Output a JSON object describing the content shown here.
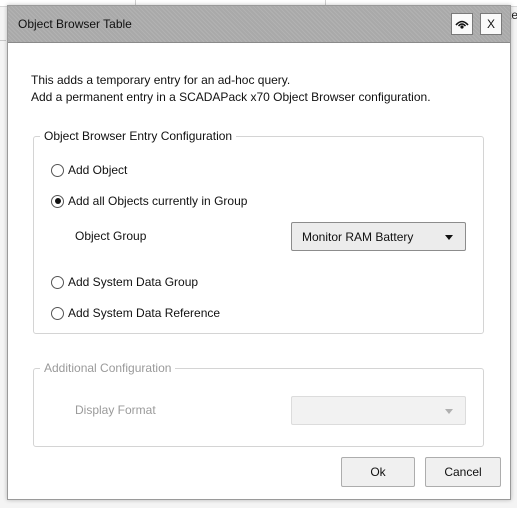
{
  "dialog": {
    "title": "Object Browser Table",
    "eye_icon": "eye-icon",
    "close_label": "X"
  },
  "background": {
    "peek_text": "te"
  },
  "intro": {
    "line1": "This adds a temporary entry for an ad-hoc query.",
    "line2": "Add a permanent entry in a SCADAPack x70 Object Browser configuration."
  },
  "entry_config": {
    "legend": "Object Browser Entry Configuration",
    "options": [
      {
        "label": "Add Object",
        "selected": false
      },
      {
        "label": "Add all Objects currently in Group",
        "selected": true
      },
      {
        "label": "Add System Data Group",
        "selected": false
      },
      {
        "label": "Add System Data Reference",
        "selected": false
      }
    ],
    "object_group_label": "Object Group",
    "object_group_value": "Monitor RAM Battery"
  },
  "additional_config": {
    "legend": "Additional Configuration",
    "display_format_label": "Display Format",
    "display_format_value": "",
    "enabled": false
  },
  "buttons": {
    "ok": "Ok",
    "cancel": "Cancel"
  }
}
